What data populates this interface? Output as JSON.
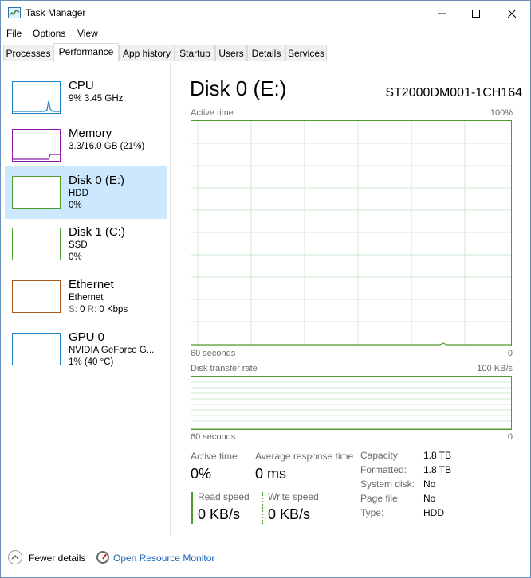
{
  "window": {
    "title": "Task Manager"
  },
  "menu": [
    "File",
    "Options",
    "View"
  ],
  "tabs": [
    "Processes",
    "Performance",
    "App history",
    "Startup",
    "Users",
    "Details",
    "Services"
  ],
  "active_tab": "Performance",
  "sidebar": {
    "items": [
      {
        "title": "CPU",
        "line1": "9%  3.45 GHz",
        "line2": "",
        "color": "#1a7fc0"
      },
      {
        "title": "Memory",
        "line1": "3.3/16.0 GB (21%)",
        "line2": "",
        "color": "#8b1aa8"
      },
      {
        "title": "Disk 0 (E:)",
        "line1": "HDD",
        "line2": "0%",
        "color": "#4f9a2e",
        "selected": true
      },
      {
        "title": "Disk 1 (C:)",
        "line1": "SSD",
        "line2": "0%",
        "color": "#4f9a2e"
      },
      {
        "title": "Ethernet",
        "line1": "Ethernet",
        "line2_label_s": "S:",
        "line2_value_s": "0",
        "line2_label_r": "R:",
        "line2_value_r": "0 Kbps",
        "color": "#a8561a"
      },
      {
        "title": "GPU 0",
        "line1": "NVIDIA GeForce G...",
        "line2": "1% (40 °C)",
        "color": "#1a7fc0"
      }
    ]
  },
  "detail": {
    "title": "Disk 0 (E:)",
    "model": "ST2000DM001-1CH164",
    "active_chart": {
      "label": "Active time",
      "max": "100%",
      "time_label": "60 seconds",
      "min": "0"
    },
    "transfer_chart": {
      "label": "Disk transfer rate",
      "max": "100 KB/s",
      "time_label": "60 seconds",
      "min": "0"
    },
    "stats": {
      "active_time_label": "Active time",
      "active_time_value": "0%",
      "avg_response_label": "Average response time",
      "avg_response_value": "0 ms",
      "read_speed_label": "Read speed",
      "read_speed_value": "0 KB/s",
      "write_speed_label": "Write speed",
      "write_speed_value": "0 KB/s"
    },
    "properties": [
      {
        "label": "Capacity:",
        "value": "1.8 TB"
      },
      {
        "label": "Formatted:",
        "value": "1.8 TB"
      },
      {
        "label": "System disk:",
        "value": "No"
      },
      {
        "label": "Page file:",
        "value": "No"
      },
      {
        "label": "Type:",
        "value": "HDD"
      }
    ]
  },
  "footer": {
    "fewer_details": "Fewer details",
    "open_resmon": "Open Resource Monitor"
  },
  "colors": {
    "disk": "#4f9a2e",
    "grid": "#d3ead0",
    "selected_bg": "#cce8ff",
    "link": "#1a64b8"
  }
}
